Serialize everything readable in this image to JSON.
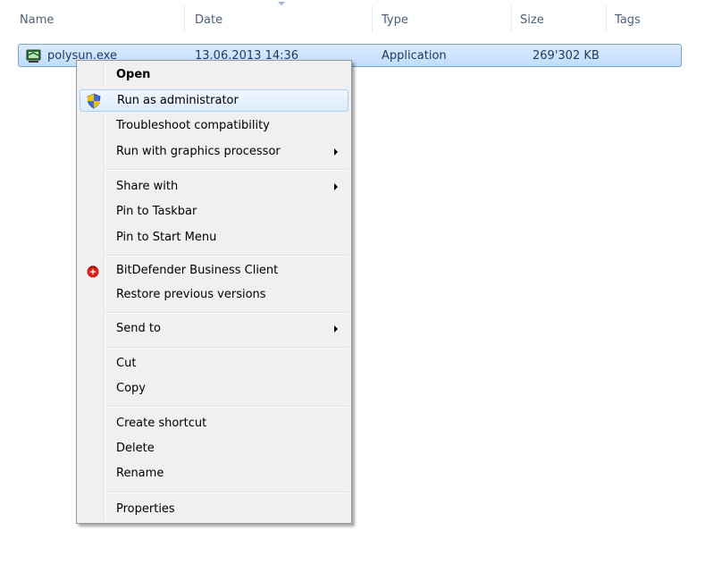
{
  "columns": {
    "name": "Name",
    "date": "Date",
    "type": "Type",
    "size": "Size",
    "tags": "Tags"
  },
  "file": {
    "name": "polysun.exe",
    "date": "13.06.2013 14:36",
    "type": "Application",
    "size": "269'302 KB"
  },
  "menu": {
    "open": "Open",
    "run_as_admin": "Run as administrator",
    "troubleshoot": "Troubleshoot compatibility",
    "run_gpu": "Run with graphics processor",
    "share_with": "Share with",
    "pin_taskbar": "Pin to Taskbar",
    "pin_start": "Pin to Start Menu",
    "bitdefender": "BitDefender Business Client",
    "restore": "Restore previous versions",
    "send_to": "Send to",
    "cut": "Cut",
    "copy": "Copy",
    "create_shortcut": "Create shortcut",
    "delete": "Delete",
    "rename": "Rename",
    "properties": "Properties"
  },
  "icons": {
    "file": "application-icon",
    "admin": "uac-shield-icon",
    "bitdefender": "bitdefender-icon"
  }
}
